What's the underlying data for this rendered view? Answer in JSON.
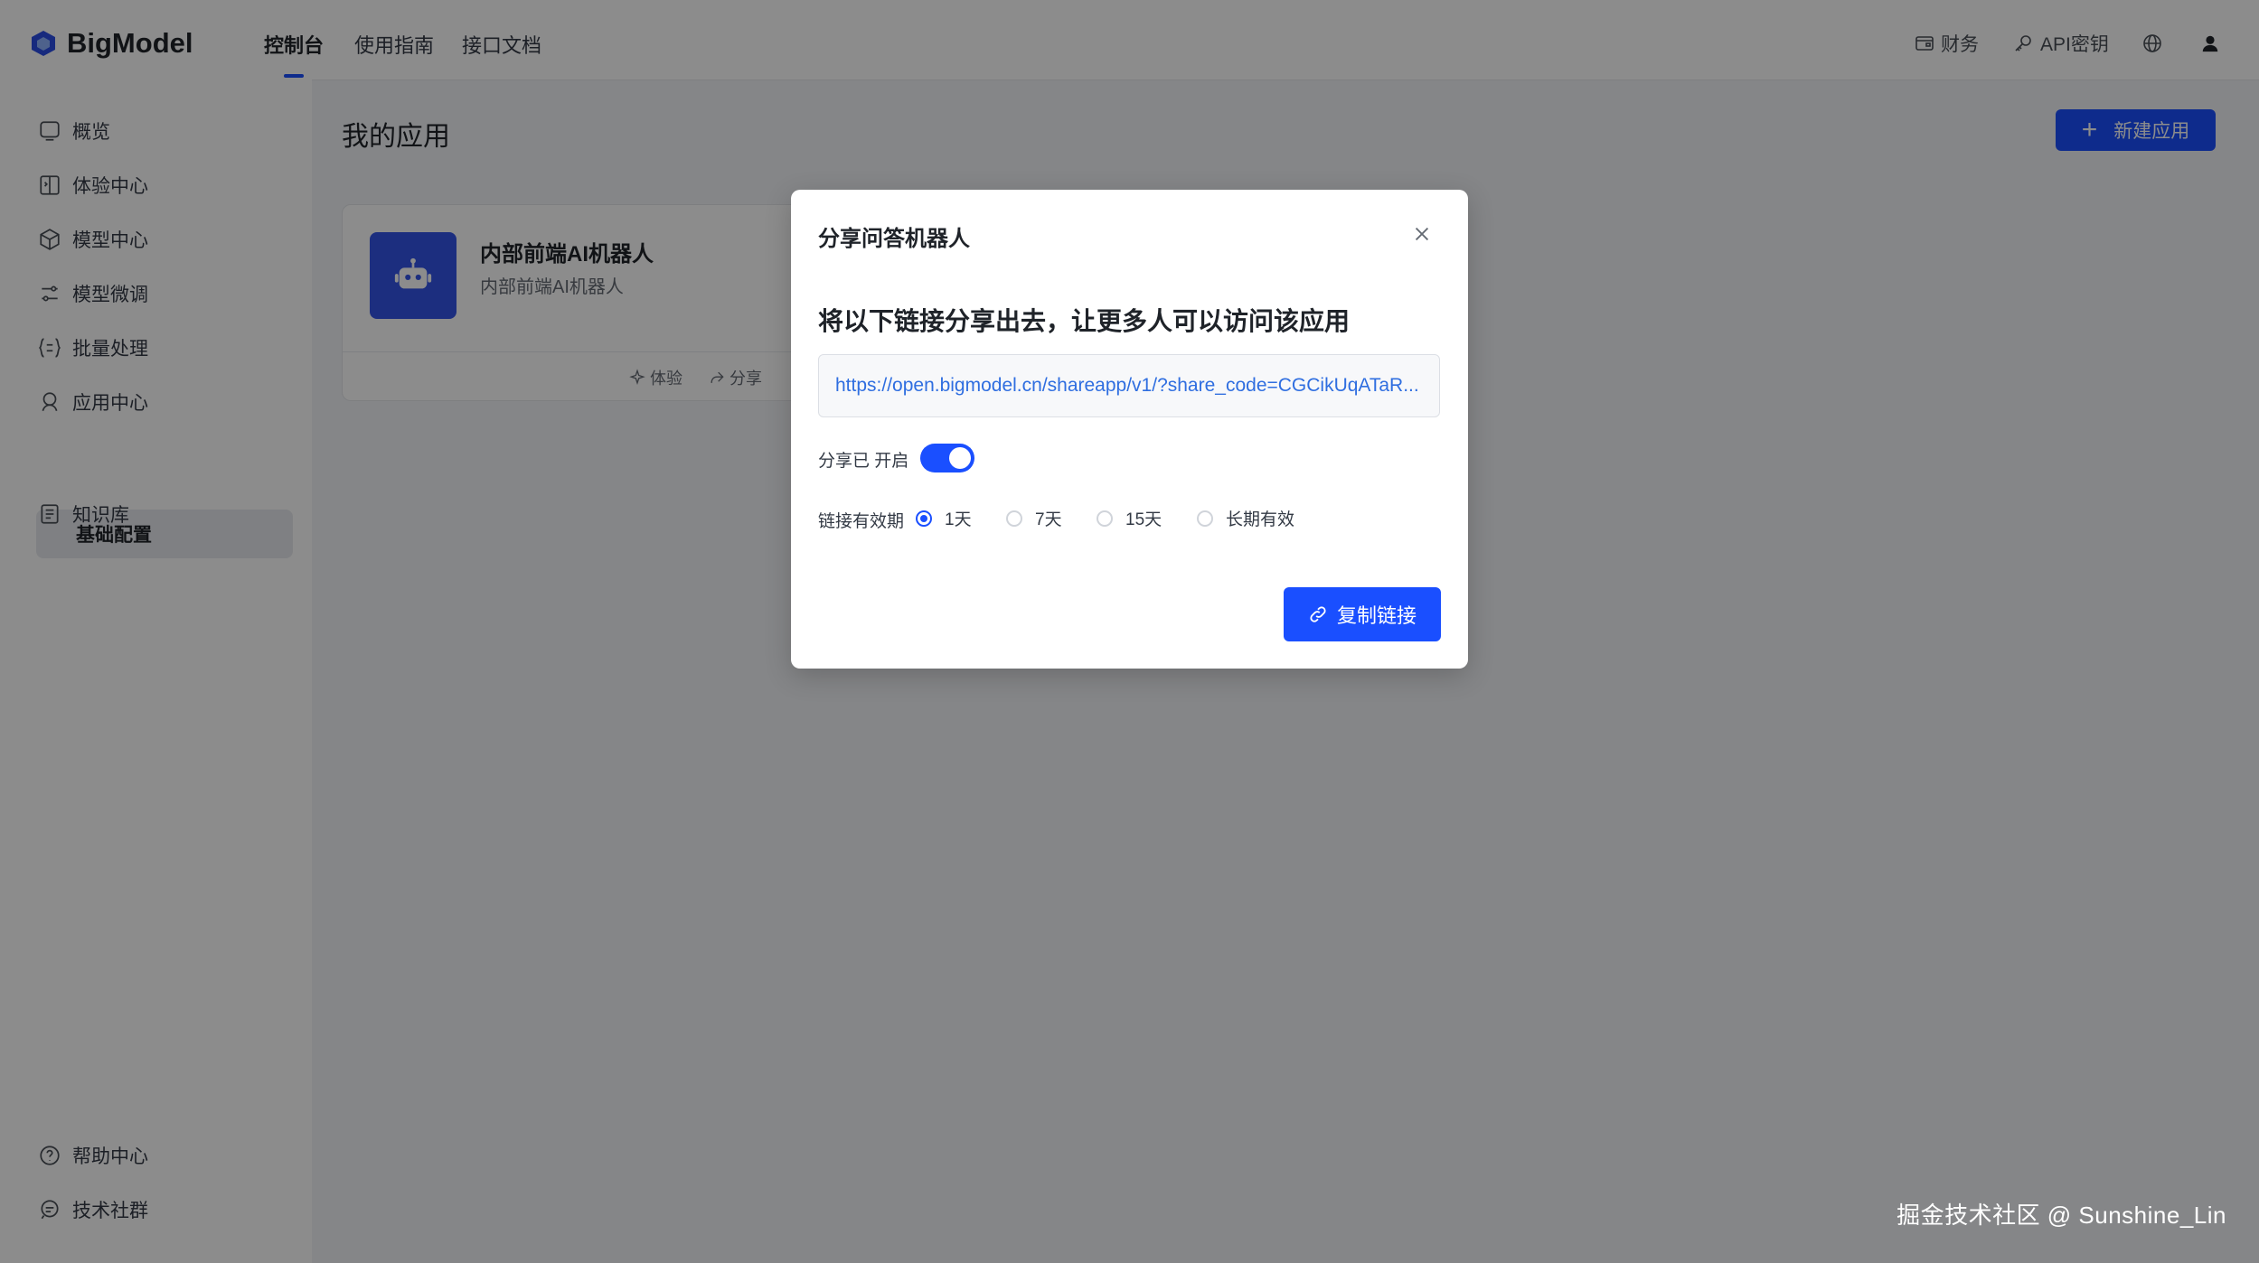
{
  "header": {
    "brand": "BigModel",
    "tabs": [
      {
        "label": "控制台",
        "active": true
      },
      {
        "label": "使用指南",
        "active": false
      },
      {
        "label": "接口文档",
        "active": false
      }
    ],
    "finance_label": "财务",
    "api_key_label": "API密钥",
    "icons": [
      "wallet-icon",
      "key-icon",
      "globe-icon",
      "user-icon"
    ]
  },
  "sidebar": {
    "items": [
      {
        "label": "概览",
        "icon": "overview-icon"
      },
      {
        "label": "体验中心",
        "icon": "experience-icon"
      },
      {
        "label": "模型中心",
        "icon": "cube-icon"
      },
      {
        "label": "模型微调",
        "icon": "sliders-icon"
      },
      {
        "label": "批量处理",
        "icon": "batch-icon"
      },
      {
        "label": "应用中心",
        "icon": "app-icon"
      },
      {
        "label": "基础配置",
        "active": true
      },
      {
        "label": "知识库",
        "icon": "book-icon"
      }
    ],
    "bottom": [
      {
        "label": "帮助中心",
        "icon": "help-icon"
      },
      {
        "label": "技术社群",
        "icon": "chat-icon"
      }
    ]
  },
  "main": {
    "title": "我的应用",
    "new_app_label": "新建应用",
    "card": {
      "name": "内部前端AI机器人",
      "description": "内部前端AI机器人",
      "actions": {
        "try": "体验",
        "share": "分享"
      }
    }
  },
  "modal": {
    "title": "分享问答机器人",
    "heading": "将以下链接分享出去，让更多人可以访问该应用",
    "url": "https://open.bigmodel.cn/shareapp/v1/?share_code=CGCikUqATaR...",
    "share_status_label": "分享已 开启",
    "share_enabled": true,
    "expiry_label": "链接有效期",
    "expiry_options": [
      "1天",
      "7天",
      "15天",
      "长期有效"
    ],
    "expiry_selected": "1天",
    "copy_label": "复制链接"
  },
  "watermark": "掘金技术社区 @ Sunshine_Lin",
  "colors": {
    "accent": "#1a4fff",
    "link": "#2f6ee0",
    "app_icon_bg": "#3355e8"
  }
}
